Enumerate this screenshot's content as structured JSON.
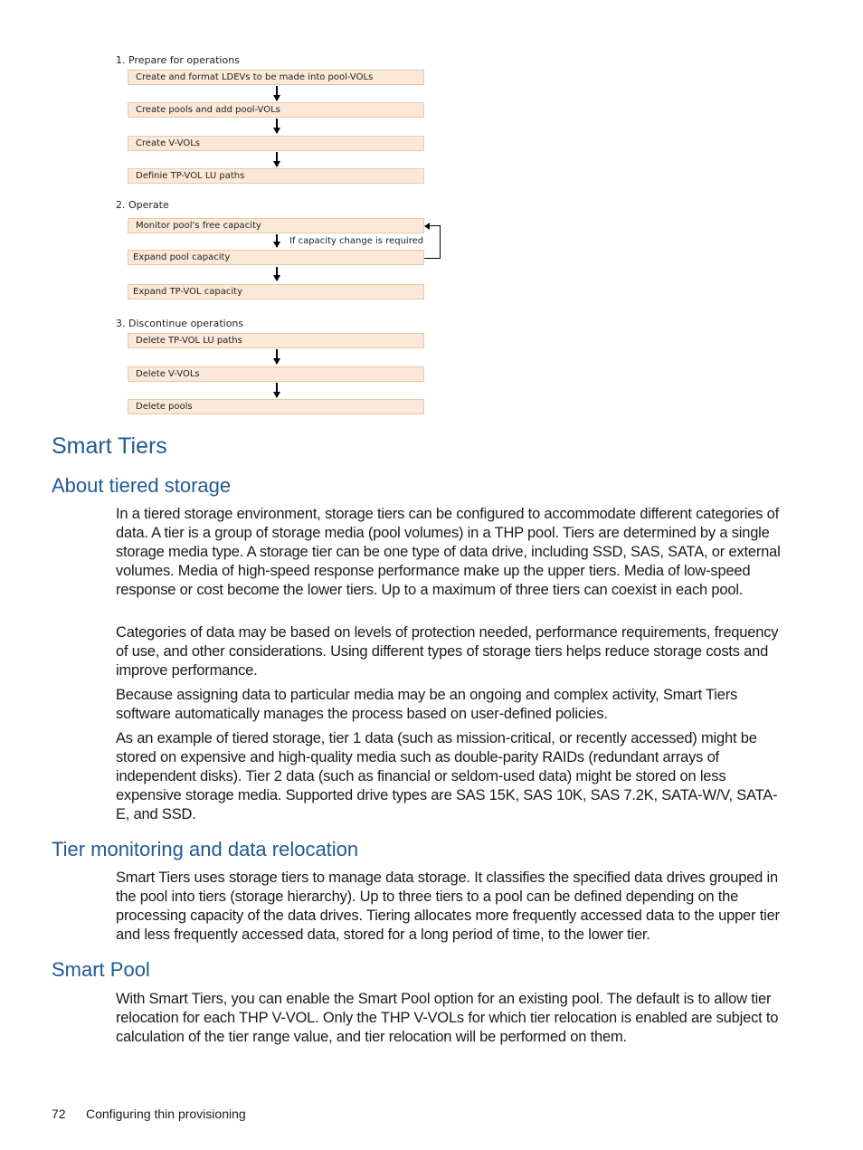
{
  "diagram": {
    "sections": [
      {
        "label": "1. Prepare for operations",
        "steps": [
          "Create and format LDEVs to be made into pool-VOLs",
          "Create pools and add pool-VOLs",
          "Create V-VOLs",
          "Definie TP-VOL LU paths"
        ]
      },
      {
        "label": "2. Operate",
        "steps": [
          "Monitor pool's free capacity",
          "Expand pool capacity",
          "Expand TP-VOL capacity"
        ],
        "loop_note": "If capacity change is required"
      },
      {
        "label": "3. Discontinue operations",
        "steps": [
          "Delete TP-VOL LU paths",
          "Delete V-VOLs",
          "Delete pools"
        ]
      }
    ]
  },
  "content": {
    "section_title": "Smart Tiers",
    "subsections": [
      {
        "title": "About tiered storage",
        "paragraphs": [
          "In a tiered storage environment, storage tiers can be configured to accommodate different categories of data. A tier is a group of storage media (pool volumes) in a THP pool. Tiers are determined by a single storage media type. A storage tier can be one type of data drive, including SSD, SAS, SATA, or external volumes. Media of high-speed response performance make up the upper tiers. Media of low-speed response or cost become the lower tiers. Up to a maximum of three tiers can coexist in each pool.",
          "Categories of data may be based on levels of protection needed, performance requirements, frequency of use, and other considerations. Using different types of storage tiers helps reduce storage costs and improve performance.",
          "Because assigning data to particular media may be an ongoing and complex activity, Smart Tiers software automatically manages the process based on user-defined policies.",
          "As an example of tiered storage, tier 1 data (such as mission-critical, or recently accessed) might be stored on expensive and high-quality media such as double-parity RAIDs (redundant arrays of independent disks). Tier 2 data (such as financial or seldom-used data) might be stored on less expensive storage media. Supported drive types are SAS 15K, SAS 10K, SAS 7.2K, SATA-W/V, SATA-E, and SSD."
        ]
      },
      {
        "title": "Tier monitoring and data relocation",
        "paragraphs": [
          "Smart Tiers uses storage tiers to manage data storage. It classifies the specified data drives grouped in the pool into tiers (storage hierarchy). Up to three tiers to a pool can be defined depending on the processing capacity of the data drives. Tiering allocates more frequently accessed data to the upper tier and less frequently accessed data, stored for a long period of time, to the lower tier."
        ]
      },
      {
        "title": "Smart Pool",
        "paragraphs": [
          "With Smart Tiers, you can enable the Smart Pool option for an existing pool. The default is to allow tier relocation for each THP V-VOL. Only the THP V-VOLs for which tier relocation is enabled are subject to calculation of the tier range value, and tier relocation will be performed on them."
        ]
      }
    ]
  },
  "footer": {
    "page_number": "72",
    "chapter_title": "Configuring thin provisioning"
  }
}
